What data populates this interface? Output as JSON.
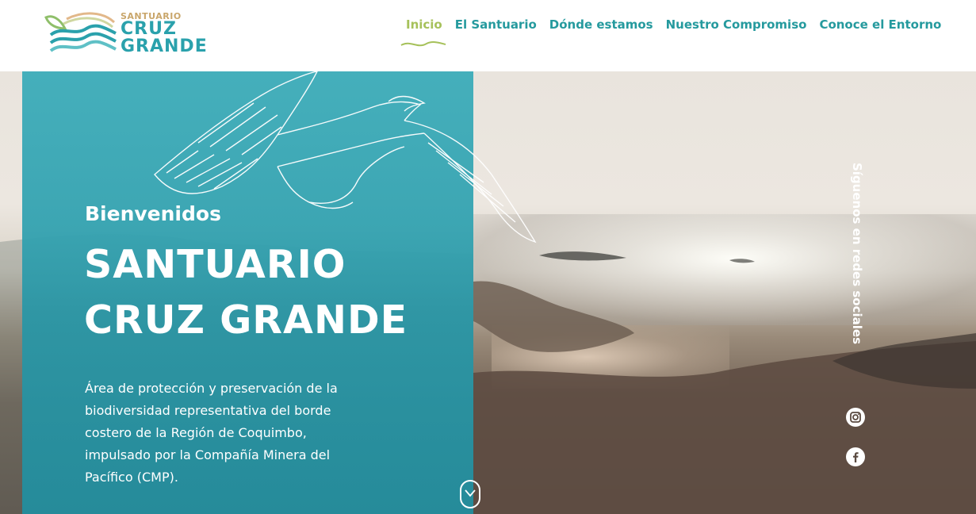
{
  "logo": {
    "line1": "SANTUARIO",
    "line2": "CRUZ",
    "line3": "GRANDE",
    "icon": "waves-leaf-logo"
  },
  "nav": {
    "items": [
      {
        "label": "Inicio",
        "active": true
      },
      {
        "label": "El Santuario",
        "active": false
      },
      {
        "label": "Dónde estamos",
        "active": false
      },
      {
        "label": "Nuestro Compromiso",
        "active": false
      },
      {
        "label": "Conoce el Entorno",
        "active": false
      }
    ]
  },
  "hero": {
    "welcome": "Bienvenidos",
    "title_line1": "SANTUARIO",
    "title_line2": "CRUZ GRANDE",
    "description": "Área de protección y preservación de la biodiversidad representativa del borde costero de la Región de Coquimbo, impulsado por la Compañía Minera del Pacífico (CMP).",
    "scroll_icon": "chevron-down-icon"
  },
  "social": {
    "label": "Síguenos en redes sociales",
    "icons": [
      "instagram-icon",
      "facebook-icon"
    ]
  },
  "colors": {
    "teal": "#2aa1ac",
    "nav_text": "#259a9e",
    "active": "#a6c15a",
    "gold": "#c9a66b"
  }
}
